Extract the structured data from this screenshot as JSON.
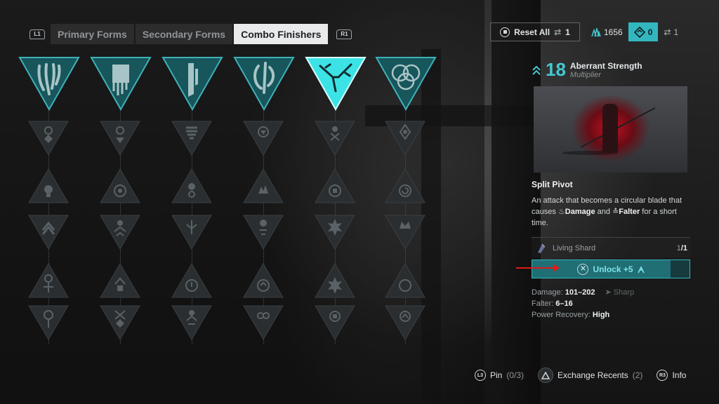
{
  "tabs": {
    "left_shoulder": "L1",
    "right_shoulder": "R1",
    "items": [
      {
        "label": "Primary Forms",
        "active": false
      },
      {
        "label": "Secondary Forms",
        "active": false
      },
      {
        "label": "Combo Finishers",
        "active": true
      }
    ]
  },
  "topbar": {
    "reset_label": "Reset All",
    "reset_count": "1",
    "currency": "1656",
    "selected_count": "0",
    "swap_count": "1"
  },
  "tree": {
    "selected_column": 5,
    "columns": [
      {
        "name": "column-1",
        "icon": "claw-glyph-icon"
      },
      {
        "name": "column-2",
        "icon": "banner-glyph-icon"
      },
      {
        "name": "column-3",
        "icon": "blade-glyph-icon"
      },
      {
        "name": "column-4",
        "icon": "spiral-glyph-icon"
      },
      {
        "name": "column-5",
        "icon": "split-pivot-icon"
      },
      {
        "name": "column-6",
        "icon": "rings-glyph-icon"
      }
    ]
  },
  "panel": {
    "level": "18",
    "title": "Aberrant Strength",
    "subtitle": "Multiplier",
    "skill_name": "Split Pivot",
    "desc_pre": "An attack that becomes a circular blade that causes ",
    "desc_damage": "Damage",
    "desc_mid": " and ",
    "desc_falter": "Falter",
    "desc_post": " for a short time.",
    "cost_item": "Living Shard",
    "cost_have": "1",
    "cost_need": "/1",
    "unlock_label": "Unlock +5",
    "stats": {
      "damage_label": "Damage:",
      "damage_value": "101–202",
      "sharp_label": "Sharp",
      "falter_label": "Falter:",
      "falter_value": "6–16",
      "power_label": "Power Recovery:",
      "power_value": "High"
    }
  },
  "footer": {
    "pin_btn": "L3",
    "pin_label": "Pin",
    "pin_count": "(0/3)",
    "exchange_label": "Exchange Recents",
    "exchange_count": "(2)",
    "info_btn": "R3",
    "info_label": "Info"
  },
  "colors": {
    "accent": "#33b7bf",
    "arrow": "#e01a1a"
  }
}
